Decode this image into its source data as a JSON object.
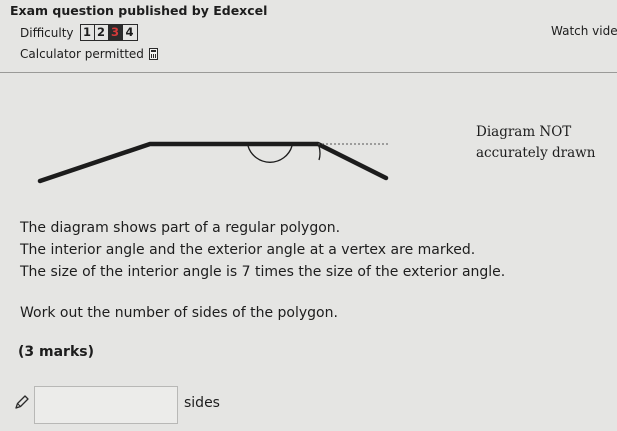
{
  "header": {
    "title": "Exam question published by Edexcel",
    "difficulty_label": "Difficulty",
    "difficulty_levels": [
      "1",
      "2",
      "3",
      "4"
    ],
    "difficulty_selected": "3",
    "watch_video": "Watch vide",
    "calculator_label": "Calculator permitted",
    "calculator_icon": "calculator-icon"
  },
  "diagram": {
    "note_line1": "Diagram NOT",
    "note_line2": "accurately drawn"
  },
  "question": {
    "line1": "The diagram shows part of a regular polygon.",
    "line2": "The interior angle and the exterior angle at a vertex are marked.",
    "line3": "The size of the interior angle is 7 times the size of the exterior angle.",
    "line4": "Work out the number of sides of the polygon.",
    "marks": "(3 marks)"
  },
  "answer": {
    "value": "",
    "unit": "sides",
    "icon": "pencil-icon"
  }
}
